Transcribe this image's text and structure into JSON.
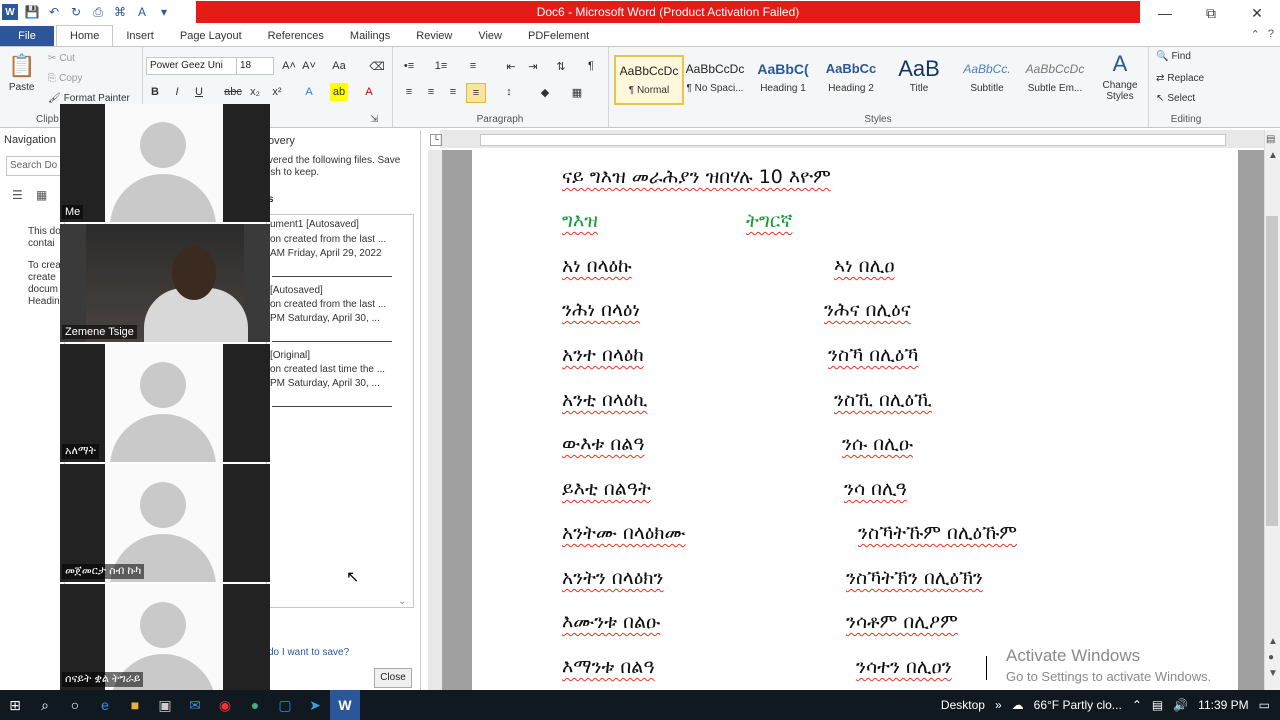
{
  "title_bar": {
    "title": "Doc6 - Microsoft Word (Product Activation Failed)",
    "colors": {
      "banner": "#e41b17"
    }
  },
  "tabs": [
    {
      "label": "File"
    },
    {
      "label": "Home"
    },
    {
      "label": "Insert"
    },
    {
      "label": "Page Layout"
    },
    {
      "label": "References"
    },
    {
      "label": "Mailings"
    },
    {
      "label": "Review"
    },
    {
      "label": "View"
    },
    {
      "label": "PDFelement"
    }
  ],
  "ribbon": {
    "clipboard": {
      "paste": "Paste",
      "cut": "Cut",
      "copy": "Copy",
      "format_painter": "Format Painter",
      "label": "Clipb"
    },
    "font": {
      "name": "Power Geez Uni",
      "size": "18"
    },
    "paragraph": {
      "label": "Paragraph"
    },
    "styles": {
      "label": "Styles",
      "items": [
        {
          "preview": "AaBbCcDc",
          "name": "¶ Normal"
        },
        {
          "preview": "AaBbCcDc",
          "name": "¶ No Spaci..."
        },
        {
          "preview": "AaBbC(",
          "name": "Heading 1"
        },
        {
          "preview": "AaBbCc",
          "name": "Heading 2"
        },
        {
          "preview": "AaB",
          "name": "Title"
        },
        {
          "preview": "AaBbCc.",
          "name": "Subtitle"
        },
        {
          "preview": "AaBbCcDc",
          "name": "Subtle Em..."
        }
      ],
      "change_styles": "Change Styles"
    },
    "editing": {
      "label": "Editing",
      "find": "Find",
      "replace": "Replace",
      "select": "Select"
    }
  },
  "nav_pane": {
    "title": "Navigation",
    "search_placeholder": "Search Do",
    "text1": "This do contai",
    "text2": "To crea create docum Headin"
  },
  "recovery_pane": {
    "title": "overy",
    "intro1": "vered the following files.  Save",
    "intro2": "ish to keep.",
    "section": "s",
    "files": [
      {
        "name": "ument1  [Autosaved]",
        "desc": "on created from the last ...",
        "time": "AM Friday, April 29, 2022"
      },
      {
        "name": "[Autosaved]",
        "desc": "on created from the last ...",
        "time": "PM Saturday, April 30, ..."
      },
      {
        "name": "[Original]",
        "desc": "on created last time the ...",
        "time": "PM Saturday, April 30, ..."
      }
    ],
    "link": "do I want to save?",
    "close": "Close"
  },
  "participants": [
    {
      "name": "Me"
    },
    {
      "name": "Zemene Tsige"
    },
    {
      "name": "አለማት"
    },
    {
      "name": "መጀመርታ  ስብ ኩካ"
    },
    {
      "name": "ሰናይት ቋል ትግራይ"
    }
  ],
  "document": {
    "heading": "ናይ ግእዝ መራሕያን ዝበሃሉ 10 እዮም",
    "col_headers": [
      "ግእዝ",
      "ትግርኛ"
    ],
    "rows": [
      {
        "geez": "አነ   በላዕኩ",
        "tigrinya": "ኣነ በሊዐ"
      },
      {
        "geez": "ንሕነ   በላዕነ",
        "tigrinya": "ንሕና በሊዕና"
      },
      {
        "geez": "አንተ በላዕከ",
        "tigrinya": "ንስኻ በሊዕኻ"
      },
      {
        "geez": "አንቲ በላዕኪ",
        "tigrinya": "ንስኺ በሊዕኺ"
      },
      {
        "geez": "ውእቱ በልዓ",
        "tigrinya": "ንሱ በሊዑ"
      },
      {
        "geez": "ይእቲ በልዓት",
        "tigrinya": "ንሳ በሊዓ"
      },
      {
        "geez": "አንትሙ በላዕክሙ",
        "tigrinya": "ንስኻትኹም በሊዕኹም"
      },
      {
        "geez": "አንትን በላዕክን",
        "tigrinya": "ንስኻትኽን በሊዕኽን"
      },
      {
        "geez": "እሙንቱ በልዑ",
        "tigrinya": "ንሳቶም በሊዖም"
      },
      {
        "geez": "እማንቱ በልዓ",
        "tigrinya": "ንሳተን በሊዐን"
      }
    ],
    "colors": {
      "header_green": "#1a9b3c"
    }
  },
  "activation": {
    "line1": "Activate Windows",
    "line2": "Go to Settings to activate Windows."
  },
  "taskbar": {
    "desktop": "Desktop",
    "weather": "66°F  Partly clo...",
    "time": "11:39 PM"
  }
}
